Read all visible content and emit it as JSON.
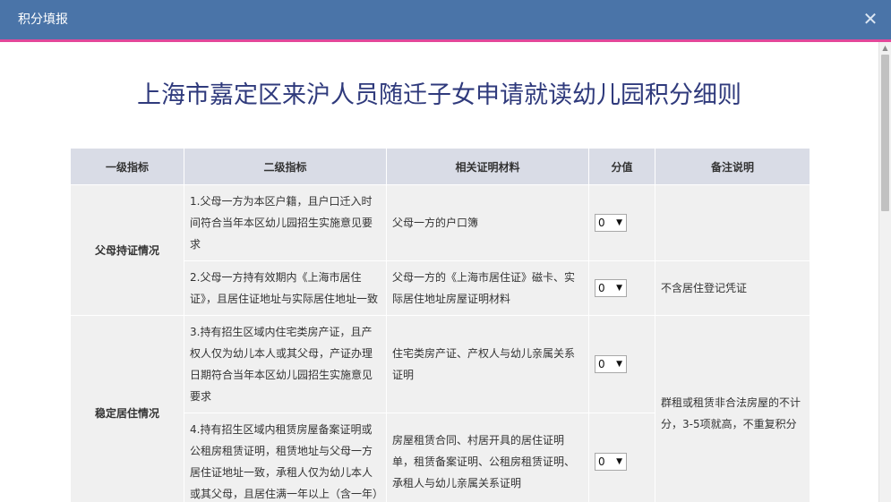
{
  "window": {
    "title": "积分填报",
    "close_symbol": "✕"
  },
  "page": {
    "heading": "上海市嘉定区来沪人员随迁子女申请就读幼儿园积分细则"
  },
  "table": {
    "headers": [
      "一级指标",
      "二级指标",
      "相关证明材料",
      "分值",
      "备注说明"
    ],
    "groups": [
      {
        "category": "父母持证情况"
      },
      {
        "category": "稳定居住情况"
      }
    ],
    "rows": [
      {
        "indicator": "1.父母一方为本区户籍，且户口迁入时间符合当年本区幼儿园招生实施意见要求",
        "material": "父母一方的户口簿",
        "score": "0",
        "note": ""
      },
      {
        "indicator": "2.父母一方持有效期内《上海市居住证》，且居住证地址与实际居住地址一致",
        "material": "父母一方的《上海市居住证》磁卡、实际居住地址房屋证明材料",
        "score": "0",
        "note": "不含居住登记凭证"
      },
      {
        "indicator": "3.持有招生区域内住宅类房产证，且产权人仅为幼儿本人或其父母，产证办理日期符合当年本区幼儿园招生实施意见要求",
        "material": "住宅类房产证、产权人与幼儿亲属关系证明",
        "score": "0",
        "note": "群租或租赁非合法房屋的不计分，3-5项就高，不重复积分"
      },
      {
        "indicator": "4.持有招生区域内租赁房屋备案证明或公租房租赁证明，租赁地址与父母一方居住证地址一致，承租人仅为幼儿本人或其父母，且居住满一年以上（含一年）",
        "material": "房屋租赁合同、村居开具的居住证明单，租赁备案证明、公租房租赁证明、承租人与幼儿亲属关系证明",
        "score": "0",
        "note": ""
      }
    ]
  },
  "icons": {
    "dropdown_caret": "caret-down-icon",
    "close": "close-icon"
  },
  "colors": {
    "titlebar": "#4a74a8",
    "accent_line": "#e3479a",
    "heading": "#2f3a7c"
  }
}
